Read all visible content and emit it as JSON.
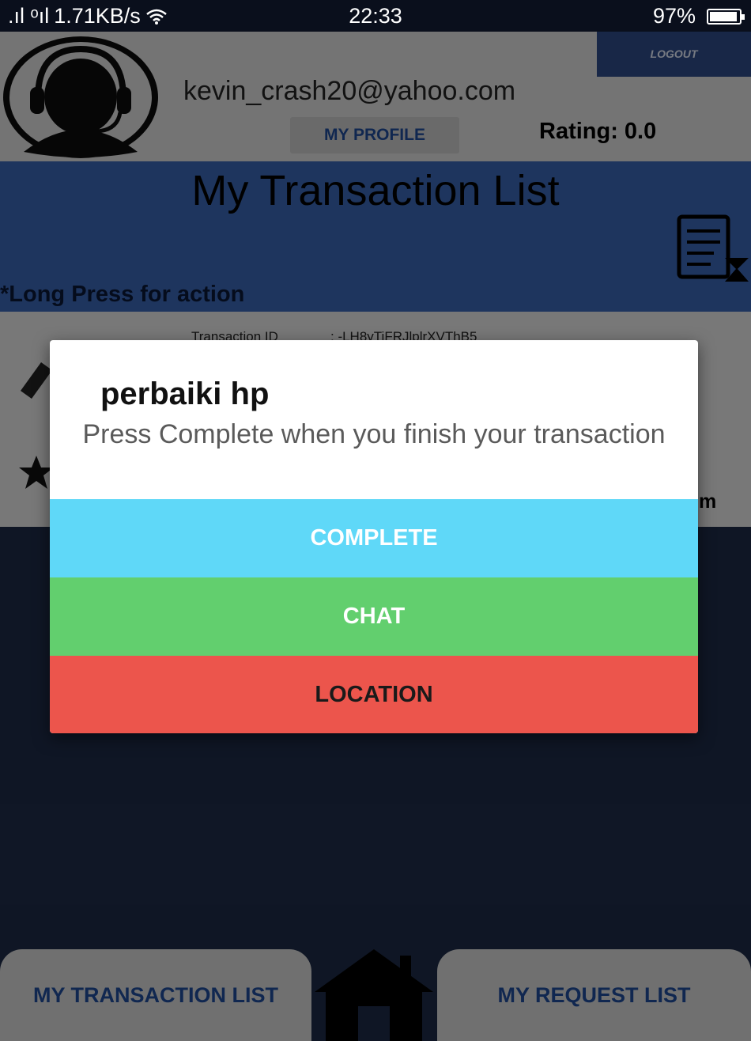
{
  "status_bar": {
    "signal": ".ıl ᵒıl",
    "speed": "1.71KB/s",
    "time": "22:33",
    "battery": "97%"
  },
  "header": {
    "email": "kevin_crash20@yahoo.com",
    "logout_label": "LOGOUT",
    "my_profile_label": "MY PROFILE",
    "rating": "Rating: 0.0"
  },
  "page": {
    "title": "My Transaction List",
    "hint": "*Long Press for action"
  },
  "card": {
    "transaction_id_label": "Transaction ID",
    "transaction_id_value": ": -LH8yTiFRJlplrXVThB5",
    "edge_text": "m"
  },
  "dialog": {
    "title": "perbaiki hp",
    "message": "Press Complete when you finish your transaction",
    "buttons": {
      "complete": "COMPLETE",
      "chat": "CHAT",
      "location": "LOCATION"
    }
  },
  "bottom_nav": {
    "left_label": "MY TRANSACTION LIST",
    "right_label": "MY REQUEST LIST"
  },
  "colors": {
    "primary_blue": "#3a65b2",
    "complete": "#5fd8f8",
    "chat": "#62cf6e",
    "location": "#ec554c"
  },
  "icons": [
    "wifi-icon",
    "battery-icon",
    "avatar-headset-icon",
    "transaction-list-icon",
    "home-icon"
  ]
}
